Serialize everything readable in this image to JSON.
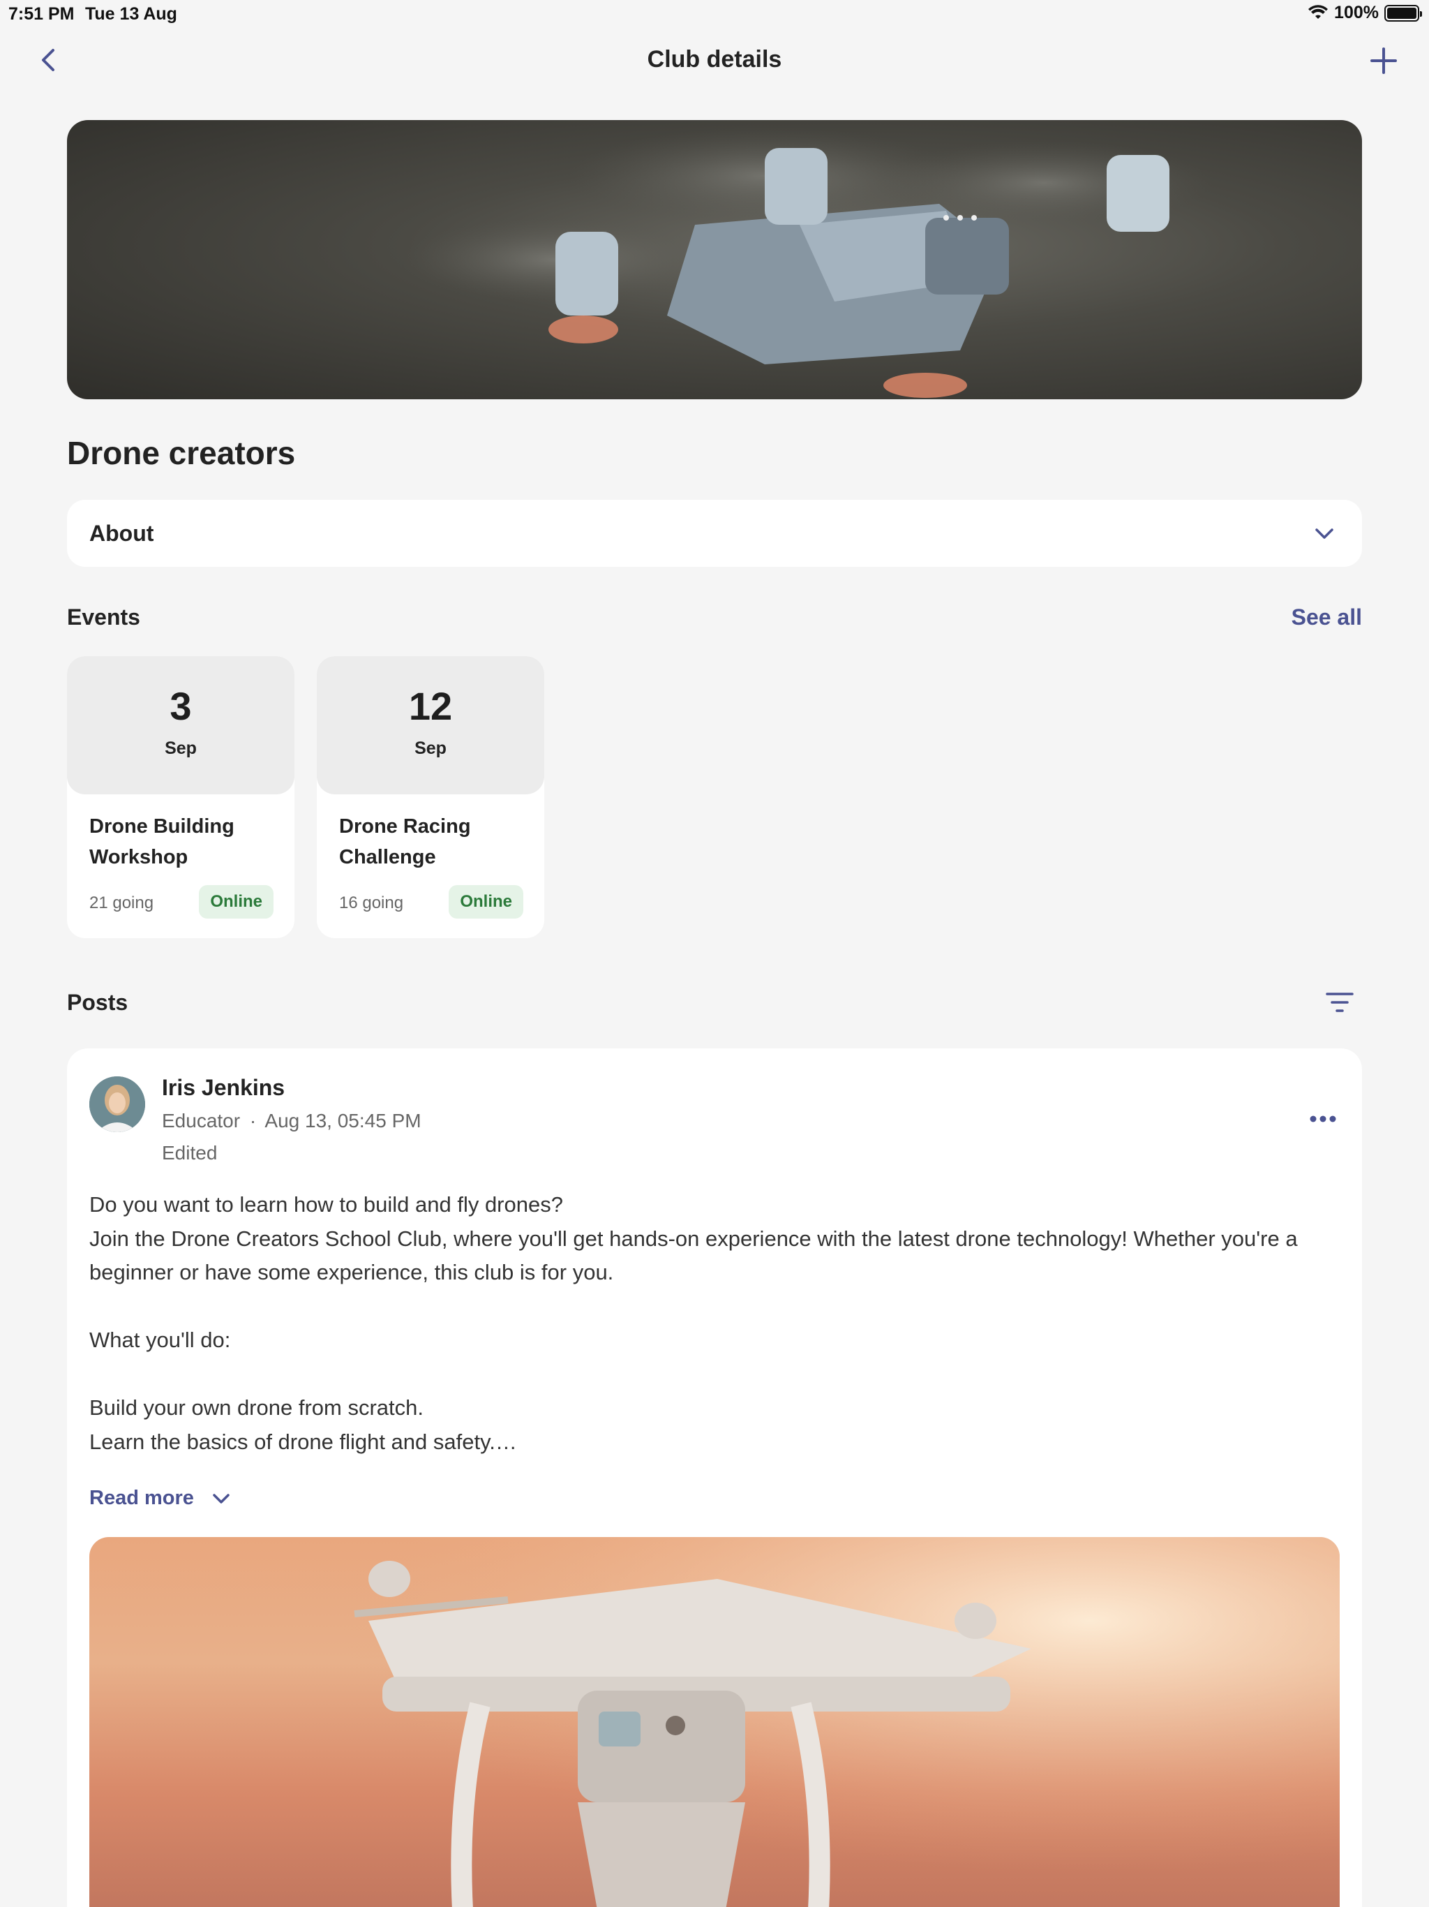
{
  "status": {
    "time": "7:51 PM",
    "date": "Tue 13 Aug",
    "battery": "100%"
  },
  "nav": {
    "title": "Club details"
  },
  "club": {
    "name": "Drone creators",
    "about_label": "About"
  },
  "events": {
    "heading": "Events",
    "see_all": "See all",
    "items": [
      {
        "day": "3",
        "month": "Sep",
        "title": "Drone Building Workshop",
        "going": "21 going",
        "badge": "Online"
      },
      {
        "day": "12",
        "month": "Sep",
        "title": "Drone Racing Challenge",
        "going": "16 going",
        "badge": "Online"
      }
    ]
  },
  "posts": {
    "heading": "Posts",
    "items": [
      {
        "author": "Iris Jenkins",
        "role": "Educator",
        "separator": "·",
        "timestamp": "Aug 13, 05:45 PM",
        "edited": "Edited",
        "body": "Do you want to learn how to build and fly drones?\nJoin the Drone Creators School Club, where you'll get hands-on experience with the latest drone technology! Whether you're a beginner or have some experience, this club is for you.\n\nWhat you'll do:\n\nBuild your own drone from scratch.\nLearn the basics of drone flight and safety.…",
        "read_more": "Read more"
      }
    ]
  },
  "colors": {
    "accent": "#4a5291",
    "background": "#f5f5f5",
    "card": "#ffffff",
    "badge_bg": "#e5f3e7",
    "badge_text": "#2b7a3a"
  }
}
